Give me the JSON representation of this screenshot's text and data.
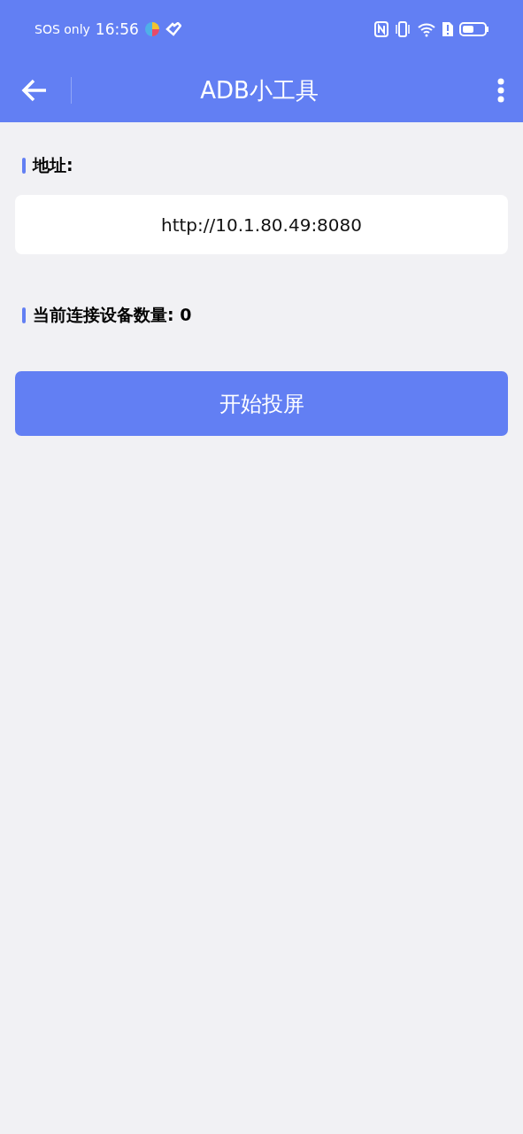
{
  "status_bar": {
    "carrier": "SOS only",
    "time": "16:56"
  },
  "app_bar": {
    "title": "ADB小工具"
  },
  "address": {
    "label": "地址:",
    "value": "http://10.1.80.49:8080"
  },
  "device_count": {
    "label": "当前连接设备数量: 0"
  },
  "buttons": [
    {
      "label": "开始投屏"
    }
  ]
}
